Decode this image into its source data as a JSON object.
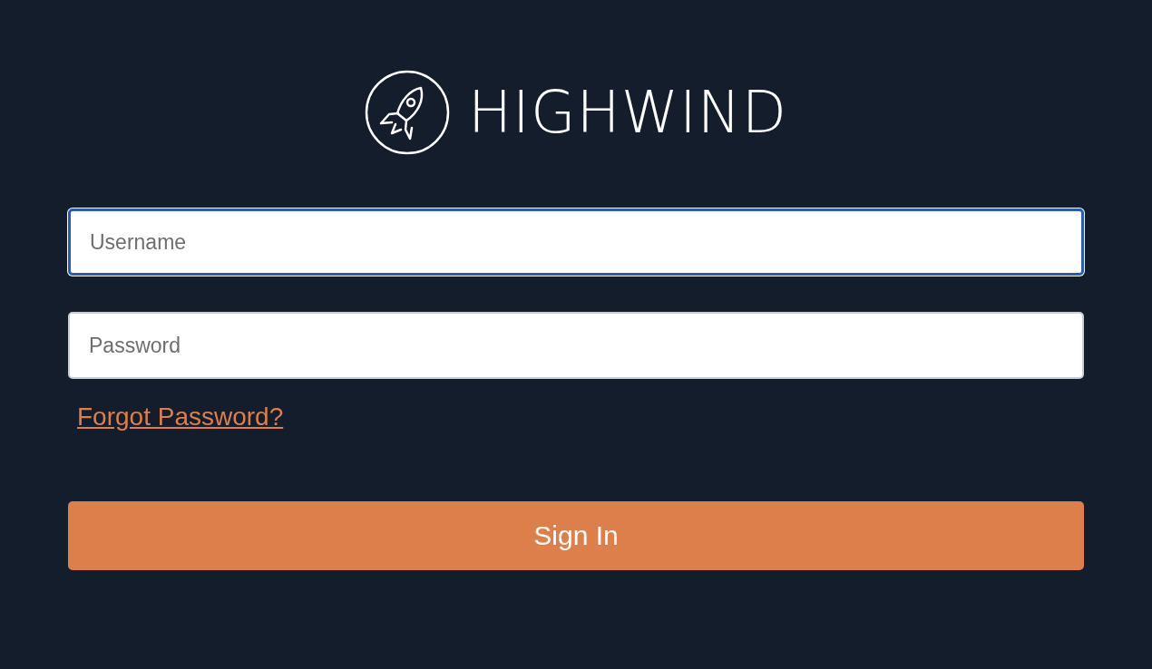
{
  "logo": {
    "text": "HIGHWIND"
  },
  "fields": [
    {
      "placeholder": "Username",
      "focused": true
    },
    {
      "placeholder": "Password",
      "focused": false
    }
  ],
  "forgot_link": "Forgot Password?",
  "sign_in_button": "Sign In"
}
